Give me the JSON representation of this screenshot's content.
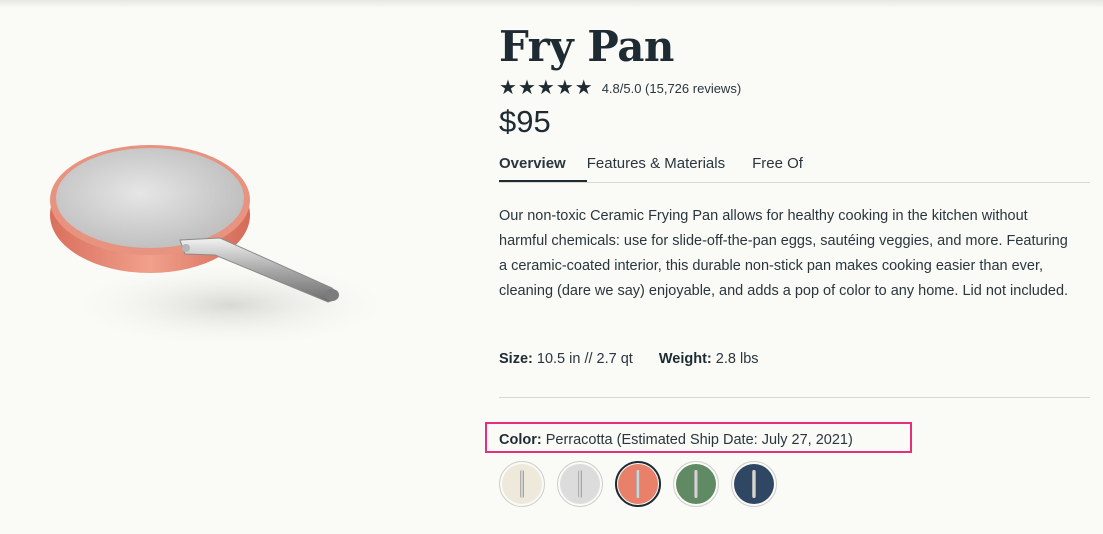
{
  "product": {
    "title": "Fry Pan",
    "rating_text": "4.8/5.0 (15,726 reviews)",
    "rating_value": 4.8,
    "rating_max": 5,
    "price": "$95"
  },
  "tabs": [
    {
      "label": "Overview",
      "active": true
    },
    {
      "label": "Features & Materials",
      "active": false
    },
    {
      "label": "Free Of",
      "active": false
    }
  ],
  "description": "Our non-toxic Ceramic Frying Pan allows for healthy cooking in the kitchen without harmful chemicals: use for slide-off-the-pan eggs, sautéing veggies, and more. Featuring a ceramic-coated interior, this durable non-stick pan makes cooking easier than ever, cleaning (dare we say) enjoyable, and adds a pop of color to any home. Lid not included.",
  "specs": {
    "size_label": "Size:",
    "size_value": "10.5 in // 2.7 qt",
    "weight_label": "Weight:",
    "weight_value": "2.8 lbs"
  },
  "color": {
    "label": "Color:",
    "value": "Perracotta (Estimated Ship Date: July 27, 2021)",
    "highlight_color": "#e62e7b",
    "swatches": [
      {
        "name": "cream",
        "hex": "#efe9dc",
        "selected": false
      },
      {
        "name": "gray",
        "hex": "#dcdcdc",
        "selected": false
      },
      {
        "name": "perracotta",
        "hex": "#e8806a",
        "selected": true
      },
      {
        "name": "sage",
        "hex": "#5f8a63",
        "selected": false
      },
      {
        "name": "navy",
        "hex": "#2f4763",
        "selected": false
      }
    ]
  },
  "icons": {
    "star": "★"
  }
}
